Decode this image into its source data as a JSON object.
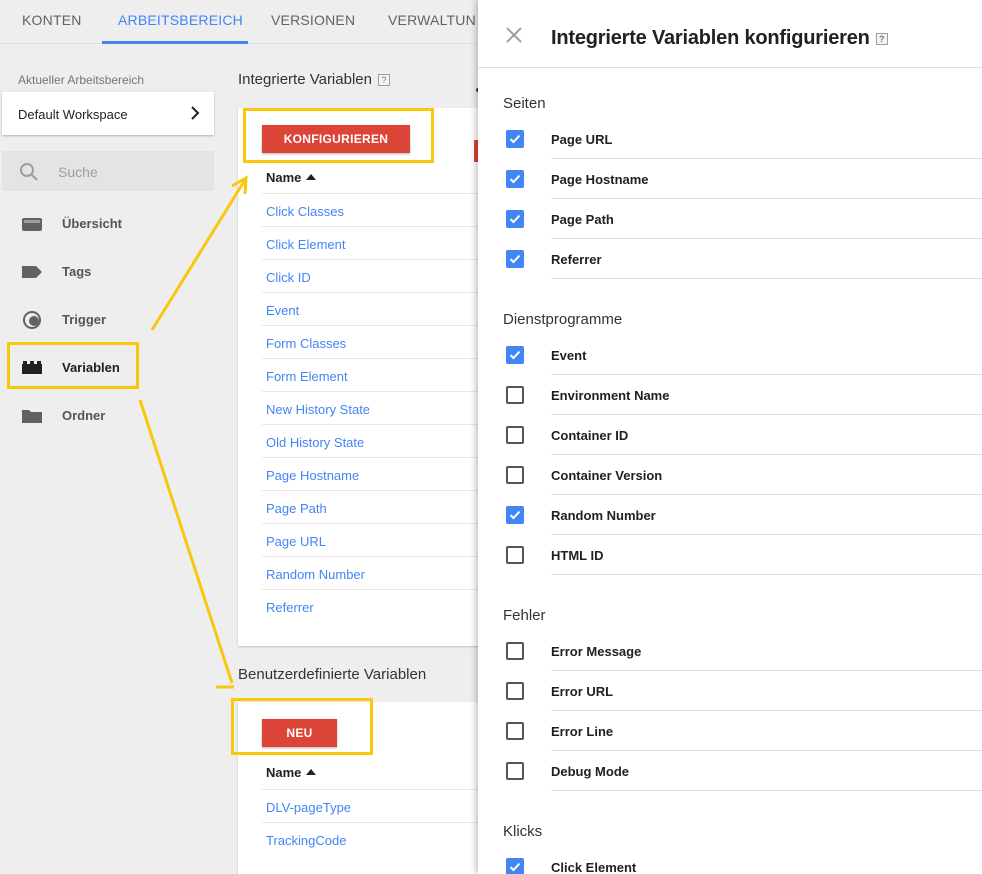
{
  "topnav": {
    "tabs": [
      {
        "label": "KONTEN",
        "active": false
      },
      {
        "label": "ARBEITSBEREICH",
        "active": true
      },
      {
        "label": "VERSIONEN",
        "active": false
      },
      {
        "label": "VERWALTUNG",
        "active": false
      }
    ]
  },
  "sidebar": {
    "workspace_label": "Aktueller Arbeitsbereich",
    "workspace_name": "Default Workspace",
    "search_placeholder": "Suche",
    "items": [
      {
        "label": "Übersicht",
        "icon": "overview-icon"
      },
      {
        "label": "Tags",
        "icon": "tag-icon"
      },
      {
        "label": "Trigger",
        "icon": "trigger-icon"
      },
      {
        "label": "Variablen",
        "icon": "variables-icon",
        "active": true
      },
      {
        "label": "Ordner",
        "icon": "folder-icon"
      }
    ]
  },
  "builtin": {
    "title": "Integrierte Variablen",
    "help": "?",
    "configure_label": "KONFIGURIEREN",
    "column_header": "Name",
    "rows": [
      "Click Classes",
      "Click Element",
      "Click ID",
      "Event",
      "Form Classes",
      "Form Element",
      "New History State",
      "Old History State",
      "Page Hostname",
      "Page Path",
      "Page URL",
      "Random Number",
      "Referrer"
    ]
  },
  "custom": {
    "title": "Benutzerdefinierte Variablen",
    "new_label": "NEU",
    "column_header": "Name",
    "rows": [
      "DLV-pageType",
      "TrackingCode"
    ]
  },
  "panel": {
    "title": "Integrierte Variablen konfigurieren",
    "help": "?",
    "groups": [
      {
        "name": "Seiten",
        "options": [
          {
            "label": "Page URL",
            "checked": true
          },
          {
            "label": "Page Hostname",
            "checked": true
          },
          {
            "label": "Page Path",
            "checked": true
          },
          {
            "label": "Referrer",
            "checked": true
          }
        ]
      },
      {
        "name": "Dienstprogramme",
        "options": [
          {
            "label": "Event",
            "checked": true
          },
          {
            "label": "Environment Name",
            "checked": false
          },
          {
            "label": "Container ID",
            "checked": false
          },
          {
            "label": "Container Version",
            "checked": false
          },
          {
            "label": "Random Number",
            "checked": true
          },
          {
            "label": "HTML ID",
            "checked": false
          }
        ]
      },
      {
        "name": "Fehler",
        "options": [
          {
            "label": "Error Message",
            "checked": false
          },
          {
            "label": "Error URL",
            "checked": false
          },
          {
            "label": "Error Line",
            "checked": false
          },
          {
            "label": "Debug Mode",
            "checked": false
          }
        ]
      },
      {
        "name": "Klicks",
        "options": [
          {
            "label": "Click Element",
            "checked": true
          }
        ]
      }
    ]
  },
  "colors": {
    "accent": "#4285f4",
    "red_button": "#db4437",
    "highlight": "#f9c70c"
  }
}
